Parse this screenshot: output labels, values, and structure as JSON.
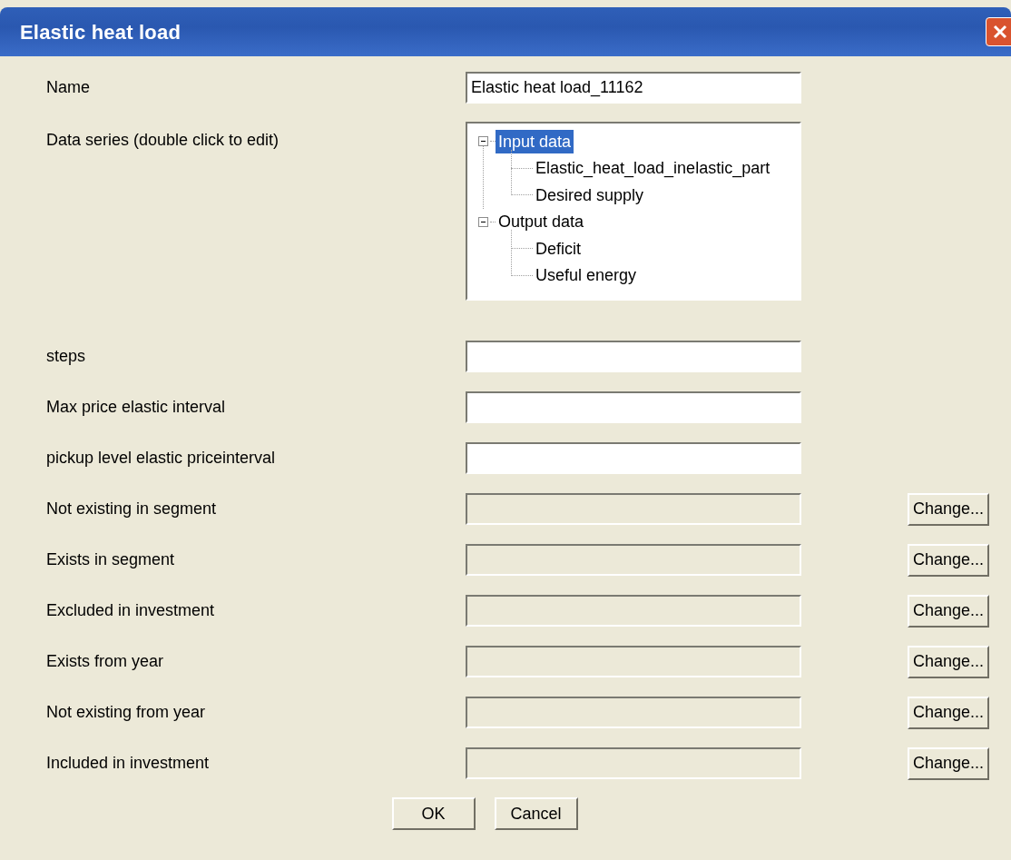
{
  "window": {
    "title": "Elastic heat load"
  },
  "rows": [
    {
      "kind": "text",
      "label": "Name",
      "value": "Elastic heat load_11162"
    },
    {
      "kind": "tree",
      "label": "Data series (double click to edit)",
      "nodes": [
        {
          "label": "Input data",
          "expanded": true,
          "selected": true,
          "children": [
            {
              "label": "Elastic_heat_load_inelastic_part",
              "selected": false
            },
            {
              "label": "Desired supply",
              "selected": false
            }
          ]
        },
        {
          "label": "Output data",
          "expanded": true,
          "selected": false,
          "children": [
            {
              "label": "Deficit",
              "selected": false
            },
            {
              "label": "Useful energy",
              "selected": false
            }
          ]
        }
      ]
    },
    {
      "kind": "text",
      "label": "steps"
    },
    {
      "kind": "text",
      "label": "Max price elastic interval"
    },
    {
      "kind": "text",
      "label": "pickup level elastic priceinterval"
    },
    {
      "kind": "locked",
      "label": "Not existing in segment",
      "button": "Change..."
    },
    {
      "kind": "locked",
      "label": "Exists in segment",
      "button": "Change..."
    },
    {
      "kind": "locked",
      "label": "Excluded in investment",
      "button": "Change..."
    },
    {
      "kind": "locked",
      "label": "Exists from year",
      "button": "Change..."
    },
    {
      "kind": "locked",
      "label": "Not existing from year",
      "button": "Change..."
    },
    {
      "kind": "locked",
      "label": "Included in investment",
      "button": "Change..."
    }
  ],
  "buttons": [
    "OK",
    "Cancel"
  ]
}
